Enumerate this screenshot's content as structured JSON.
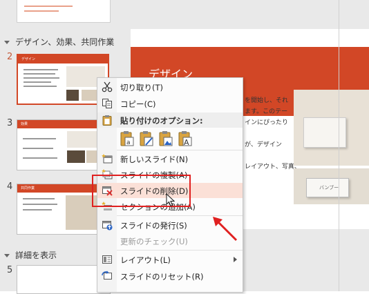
{
  "thumbnails": {
    "section_design": "デザイン、効果、共同作業",
    "section_details": "詳細を表示",
    "slides": [
      {
        "num": "2",
        "title": "デザイン",
        "selected": true
      },
      {
        "num": "3",
        "title": "効果"
      },
      {
        "num": "4",
        "title": "共同作業"
      },
      {
        "num": "5"
      }
    ]
  },
  "main_slide": {
    "title": "デザイン",
    "body_lines": [
      "を開始し、それ",
      "ます。このテー",
      "インにぴったり",
      "が、デザイン",
      "レイアウト、写真、"
    ],
    "photo_label": "バンブー"
  },
  "context_menu": {
    "cut": "切り取り(T)",
    "copy": "コピー(C)",
    "paste_options": "貼り付けのオプション:",
    "new_slide": "新しいスライド(N)",
    "duplicate_slide": "スライドの複製(A)",
    "delete_slide": "スライドの削除(D)",
    "add_section": "セクションの追加(A)",
    "publish_slides": "スライドの発行(S)",
    "check_updates": "更新のチェック(U)",
    "layout": "レイアウト(L)",
    "reset_slide": "スライドのリセット(R)"
  },
  "colors": {
    "accent": "#d24726",
    "highlight": "#fbe0d7",
    "annotation_red": "#e02020"
  }
}
